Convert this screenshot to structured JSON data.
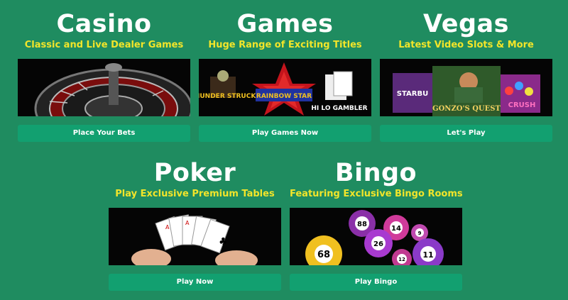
{
  "colors": {
    "background": "#1f8c60",
    "heading": "#ffffff",
    "subtitle": "#f2e52a",
    "button": "#12a070",
    "banner": "#000000"
  },
  "cards": [
    {
      "title": "Casino",
      "subtitle": "Classic and Live Dealer Games",
      "button": "Place Your Bets",
      "image": "roulette-wheel-image"
    },
    {
      "title": "Games",
      "subtitle": "Huge Range of Exciting Titles",
      "button": "Play Games Now",
      "image": "slot-games-logos-image",
      "logos": [
        "THUNDER STRUCK",
        "RAINBOW STAR",
        "HI LO GAMBLER"
      ]
    },
    {
      "title": "Vegas",
      "subtitle": "Latest Video Slots & More",
      "button": "Let's Play",
      "image": "video-slots-image",
      "logos": [
        "STARBU",
        "GONZO'S QUEST",
        "CRUSH"
      ]
    },
    {
      "title": "Poker",
      "subtitle": "Play Exclusive Premium Tables",
      "button": "Play Now",
      "image": "playing-cards-hand-image"
    },
    {
      "title": "Bingo",
      "subtitle": "Featuring Exclusive Bingo Rooms",
      "button": "Play Bingo",
      "image": "bingo-balls-image",
      "balls": [
        "88",
        "14",
        "9",
        "68",
        "26",
        "11",
        "12"
      ]
    }
  ]
}
